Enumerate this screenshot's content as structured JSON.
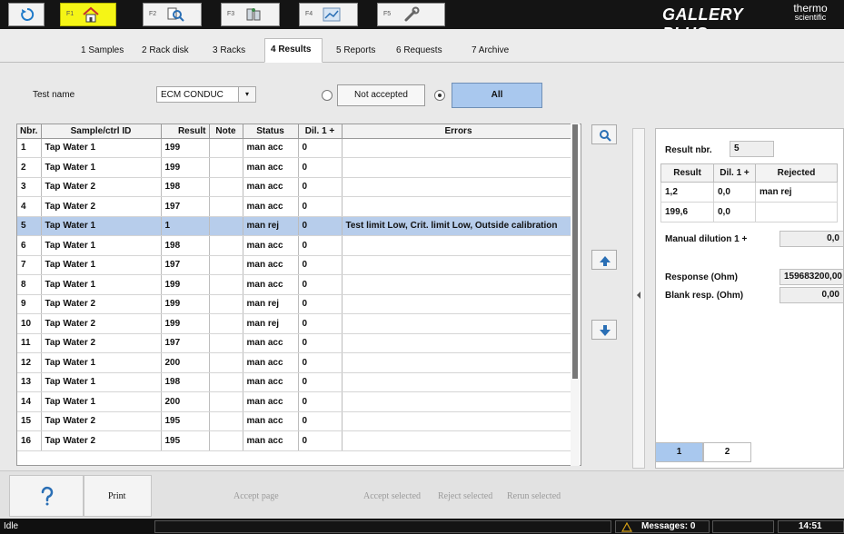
{
  "toolbar": {
    "keys": [
      {
        "label": "",
        "icon": "refresh-icon"
      },
      {
        "label": "F1",
        "icon": "home-icon"
      },
      {
        "label": "F2",
        "icon": "search-icon"
      },
      {
        "label": "F3",
        "icon": "samples-icon"
      },
      {
        "label": "F4",
        "icon": "chart-icon"
      },
      {
        "label": "F5",
        "icon": "wrench-icon"
      }
    ],
    "brand": "GALLERY PLUS",
    "vendor_line1": "thermo",
    "vendor_line2": "scientific"
  },
  "tabs": [
    {
      "label": "1 Samples"
    },
    {
      "label": "2 Rack disk"
    },
    {
      "label": "3 Racks"
    },
    {
      "label": "4 Results",
      "active": true
    },
    {
      "label": "5 Reports"
    },
    {
      "label": "6 Requests"
    },
    {
      "label": "7 Archive"
    }
  ],
  "filter": {
    "test_name_label": "Test name",
    "test_name_value": "ECM CONDUC",
    "not_accepted_label": "Not accepted",
    "all_label": "All"
  },
  "table": {
    "headers": [
      "Nbr.",
      "Sample/ctrl ID",
      "Result",
      "Note",
      "Status",
      "Dil. 1 +",
      "Errors"
    ],
    "rows": [
      {
        "nbr": "1",
        "id": "Tap Water 1",
        "result": "199",
        "note": "",
        "status": "man acc",
        "dil": "0",
        "errors": ""
      },
      {
        "nbr": "2",
        "id": "Tap Water 1",
        "result": "199",
        "note": "",
        "status": "man acc",
        "dil": "0",
        "errors": ""
      },
      {
        "nbr": "3",
        "id": "Tap Water 2",
        "result": "198",
        "note": "",
        "status": "man acc",
        "dil": "0",
        "errors": ""
      },
      {
        "nbr": "4",
        "id": "Tap Water 2",
        "result": "197",
        "note": "",
        "status": "man acc",
        "dil": "0",
        "errors": ""
      },
      {
        "nbr": "5",
        "id": "Tap Water 1",
        "result": "1",
        "note": "",
        "status": "man rej",
        "dil": "0",
        "errors": "Test limit Low, Crit. limit Low, Outside calibration"
      },
      {
        "nbr": "6",
        "id": "Tap Water 1",
        "result": "198",
        "note": "",
        "status": "man acc",
        "dil": "0",
        "errors": ""
      },
      {
        "nbr": "7",
        "id": "Tap Water 1",
        "result": "197",
        "note": "",
        "status": "man acc",
        "dil": "0",
        "errors": ""
      },
      {
        "nbr": "8",
        "id": "Tap Water 1",
        "result": "199",
        "note": "",
        "status": "man acc",
        "dil": "0",
        "errors": ""
      },
      {
        "nbr": "9",
        "id": "Tap Water 2",
        "result": "199",
        "note": "",
        "status": "man rej",
        "dil": "0",
        "errors": ""
      },
      {
        "nbr": "10",
        "id": "Tap Water 2",
        "result": "199",
        "note": "",
        "status": "man rej",
        "dil": "0",
        "errors": ""
      },
      {
        "nbr": "11",
        "id": "Tap Water 2",
        "result": "197",
        "note": "",
        "status": "man acc",
        "dil": "0",
        "errors": ""
      },
      {
        "nbr": "12",
        "id": "Tap Water 1",
        "result": "200",
        "note": "",
        "status": "man acc",
        "dil": "0",
        "errors": ""
      },
      {
        "nbr": "13",
        "id": "Tap Water 1",
        "result": "198",
        "note": "",
        "status": "man acc",
        "dil": "0",
        "errors": ""
      },
      {
        "nbr": "14",
        "id": "Tap Water 1",
        "result": "200",
        "note": "",
        "status": "man acc",
        "dil": "0",
        "errors": ""
      },
      {
        "nbr": "15",
        "id": "Tap Water 2",
        "result": "195",
        "note": "",
        "status": "man acc",
        "dil": "0",
        "errors": ""
      },
      {
        "nbr": "16",
        "id": "Tap Water 2",
        "result": "195",
        "note": "",
        "status": "man acc",
        "dil": "0",
        "errors": ""
      }
    ],
    "selected_row_index": 4,
    "selected_color": "#b7cdeb"
  },
  "right_panel": {
    "result_nbr_label": "Result nbr.",
    "result_nbr_value": "5",
    "sub_headers": [
      "Result",
      "Dil. 1 +",
      "Rejected"
    ],
    "sub_rows": [
      {
        "result": "1,2",
        "dil": "0,0",
        "rejected": "man rej"
      },
      {
        "result": "199,6",
        "dil": "0,0",
        "rejected": ""
      }
    ],
    "manual_dilution_label": "Manual dilution 1 +",
    "manual_dilution_value": "0,0",
    "response_label": "Response (Ohm)",
    "response_value": "159683200,00",
    "blank_label": "Blank resp. (Ohm)",
    "blank_value": "0,00",
    "page_tabs": [
      "1",
      "2"
    ]
  },
  "bottom": {
    "print_label": "Print",
    "accept_page": "Accept page",
    "accept_selected": "Accept selected",
    "reject_selected": "Reject selected",
    "rerun_selected": "Rerun selected"
  },
  "status": {
    "state": "Idle",
    "messages": "Messages: 0",
    "time": "14:51"
  },
  "colors": {
    "accent_active": "#f5f516",
    "all_button": "#a9c8ee",
    "top_bar": "#141414"
  }
}
